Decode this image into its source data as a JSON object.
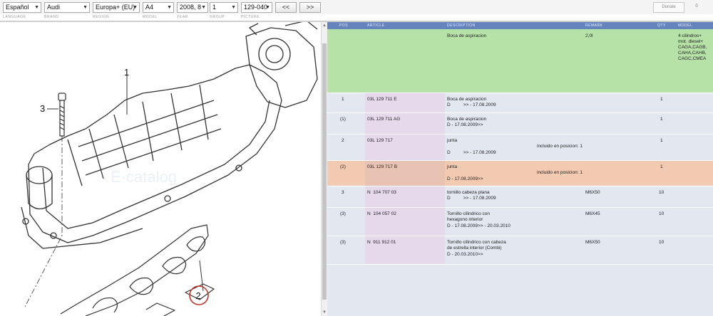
{
  "toolbar": {
    "language": "Español",
    "brand": "Audi",
    "region": "Europa+ (EU)",
    "model": "A4",
    "year": "2008, 8",
    "group": "1",
    "picture": "129-040",
    "prev_label": "<<",
    "next_label": ">>",
    "donate_label": "Donate",
    "donate_extra": "0"
  },
  "labels": {
    "language": "LANGUAGE",
    "brand": "BRAND",
    "region": "REGION",
    "model": "MODEL",
    "year": "YEAR",
    "group": "GROUP",
    "picture": "PICTURE"
  },
  "diagram": {
    "callout_1": "1",
    "callout_2": "2",
    "callout_3": "3"
  },
  "table": {
    "headers": {
      "pos": "POS",
      "article": "ARTICLE",
      "description": "DESCRIPTION",
      "remark": "REMARK",
      "qty": "QTY",
      "model": "MODEL"
    },
    "header_row": {
      "description": "Boca de aspiracion",
      "remark": "2,0l",
      "model_lines": [
        "4 cilindros+",
        "mot. diesel+",
        "CAGA,CAGB,",
        "CAHA,CAHB,",
        "CAGC,CMEA"
      ]
    },
    "rows": [
      {
        "pos": "1",
        "article": "03L 129 711 E",
        "desc": "Boca de aspiracion",
        "desc2": "D          >> - 17.08.2009",
        "desc3": "",
        "mid": "",
        "remark": "",
        "qty": "1"
      },
      {
        "pos": "(1)",
        "article": "03L 129 711 AG",
        "desc": "Boca de aspiracion",
        "desc2": "D - 17.08.2009>>",
        "desc3": "",
        "mid": "",
        "remark": "",
        "qty": "1"
      },
      {
        "pos": "2",
        "article": "03L 129 717",
        "desc": "junta",
        "desc2": "D          >> - 17.08.2009",
        "desc3": "",
        "mid": "incluido en posicion: 1",
        "remark": "",
        "qty": "1"
      },
      {
        "pos": "(2)",
        "article": "03L 129 717 B",
        "desc": "junta",
        "desc2": "D - 17.08.2009>>",
        "desc3": "",
        "mid": "incluido en posicion: 1",
        "remark": "",
        "qty": "1"
      },
      {
        "pos": "3",
        "article": "N  104 707 03",
        "desc": "tornillo cabeza plana",
        "desc2": "D          >> - 17.08.2009",
        "desc3": "",
        "mid": "",
        "remark": "M6X50",
        "qty": "10"
      },
      {
        "pos": "(3)",
        "article": "N  104 057 02",
        "desc": "Tornillo cilindrico con",
        "desc2": "hexagono interior",
        "desc3": "D - 17.08.2009>> - 20.03.2010",
        "mid": "",
        "remark": "M6X45",
        "qty": "10"
      },
      {
        "pos": "(3)",
        "article": "N  911 912 01",
        "desc": "Tornillo cilindrico con cabeza",
        "desc2": "de estrella interior (Combi)",
        "desc3": "D - 20.03.2010>>",
        "mid": "",
        "remark": "M6X50",
        "qty": "10"
      }
    ]
  },
  "colors": {
    "header_bar": "#6583bd",
    "header_row": "#b6e2a8",
    "highlight_row": "#f2c9b1",
    "article_column": "#e6d9ec",
    "table_bg": "#e3e7ef",
    "callout_circle": "#c0392b"
  }
}
